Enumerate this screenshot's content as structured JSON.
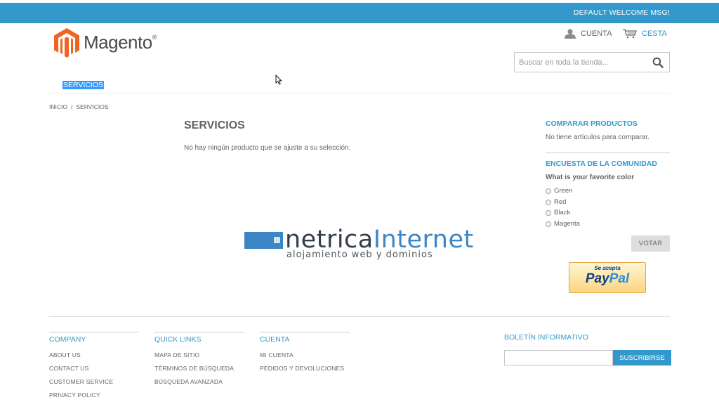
{
  "header": {
    "welcome": "DEFAULT WELCOME MSG!",
    "logo_text": "Magento",
    "logo_reg": "®",
    "account_label": "CUENTA",
    "cart_label": "CESTA",
    "search_placeholder": "Buscar en toda la tienda..."
  },
  "nav": {
    "items": [
      {
        "label": "SERVICIOS"
      }
    ]
  },
  "breadcrumb": {
    "home": "INICIO",
    "separator": "/",
    "current": "SERVICIOS"
  },
  "main": {
    "title": "SERVICIOS",
    "empty_note": "No hay ningún producto que se ajuste a su selección."
  },
  "sidebar": {
    "compare_title": "COMPARAR PRODUCTOS",
    "compare_text": "No tiene artículos para comparar.",
    "poll_title": "ENCUESTA DE LA COMUNIDAD",
    "poll_question": "What is your favorite color",
    "poll_options": [
      "Green",
      "Red",
      "Black",
      "Magenta"
    ],
    "vote_label": "VOTAR",
    "paypal_accept": "Se acepta",
    "paypal_brand_a": "Pay",
    "paypal_brand_b": "Pal"
  },
  "watermark": {
    "brand_a": "netrica",
    "brand_b": "Internet",
    "tagline": "alojamiento web y dominios"
  },
  "footer": {
    "columns": [
      {
        "title": "COMPANY",
        "links": [
          "ABOUT US",
          "CONTACT US",
          "CUSTOMER SERVICE",
          "PRIVACY POLICY"
        ]
      },
      {
        "title": "QUICK LINKS",
        "links": [
          "MAPA DE SITIO",
          "TÉRMINOS DE BÚSQUEDA",
          "BÚSQUEDA AVANZADA"
        ]
      },
      {
        "title": "CUENTA",
        "links": [
          "MI CUENTA",
          "PEDIDOS Y DEVOLUCIONES"
        ]
      }
    ],
    "newsletter_title": "BOLETÍN INFORMATIVO",
    "subscribe_label": "SUSCRIBIRSE"
  },
  "colors": {
    "accent": "#3399cc",
    "selection": "#3399ff",
    "text": "#636363"
  }
}
